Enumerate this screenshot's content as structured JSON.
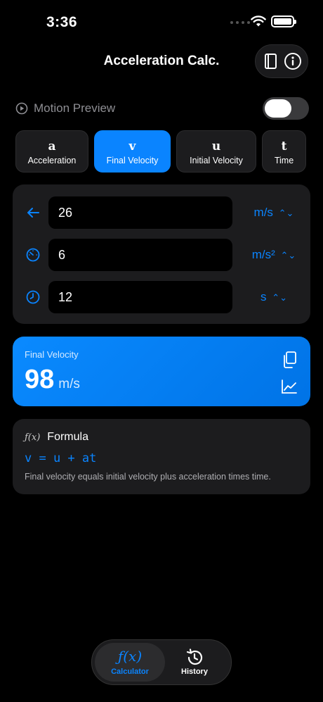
{
  "status": {
    "time": "3:36"
  },
  "header": {
    "title": "Acceleration Calc."
  },
  "motion_preview": {
    "label": "Motion Preview",
    "enabled": false
  },
  "tabs": [
    {
      "symbol": "a",
      "label": "Acceleration",
      "active": false
    },
    {
      "symbol": "v",
      "label": "Final Velocity",
      "active": true
    },
    {
      "symbol": "u",
      "label": "Initial Velocity",
      "active": false
    },
    {
      "symbol": "t",
      "label": "Time",
      "active": false
    }
  ],
  "inputs": [
    {
      "icon": "arrow-left-icon",
      "value": "26",
      "unit": "m/s"
    },
    {
      "icon": "gauge-icon",
      "value": "6",
      "unit": "m/s²"
    },
    {
      "icon": "clock-icon",
      "value": "12",
      "unit": "s"
    }
  ],
  "result": {
    "label": "Final Velocity",
    "value": "98",
    "unit": "m/s"
  },
  "formula": {
    "icon": "ƒ(x)",
    "title": "Formula",
    "expression": "v = u + at",
    "description": "Final velocity equals initial velocity plus acceleration times time."
  },
  "bottom_nav": [
    {
      "label": "Calculator",
      "icon": "ƒ(x)",
      "active": true
    },
    {
      "label": "History",
      "icon": "history-icon",
      "active": false
    }
  ],
  "colors": {
    "accent": "#0a84ff",
    "card": "#1c1c1e",
    "background": "#000000"
  }
}
